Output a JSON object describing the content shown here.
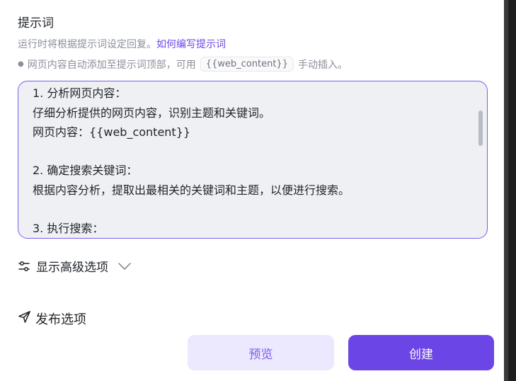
{
  "prompt": {
    "title": "提示词",
    "description": "运行时将根据提示词设定回复。",
    "help_link": "如何编写提示词",
    "hint_prefix": "网页内容自动添加至提示词顶部，可用",
    "hint_variable": "{{web_content}}",
    "hint_suffix": "手动插入。"
  },
  "editor": {
    "lines": [
      "1. 分析网页内容：",
      "仔细分析提供的网页内容，识别主题和关键词。",
      "网页内容：{{web_content}}",
      "",
      "2. 确定搜索关键词：",
      "根据内容分析，提取出最相关的关键词和主题，以便进行搜索。",
      "",
      "3. 执行搜索："
    ]
  },
  "advanced": {
    "label": "显示高级选项"
  },
  "publish": {
    "label": "发布选项"
  },
  "buttons": {
    "preview": "预览",
    "create": "创建"
  },
  "colors": {
    "accent": "#6b45e6",
    "accent_light": "#ece8fd",
    "link": "#6b45e6"
  }
}
